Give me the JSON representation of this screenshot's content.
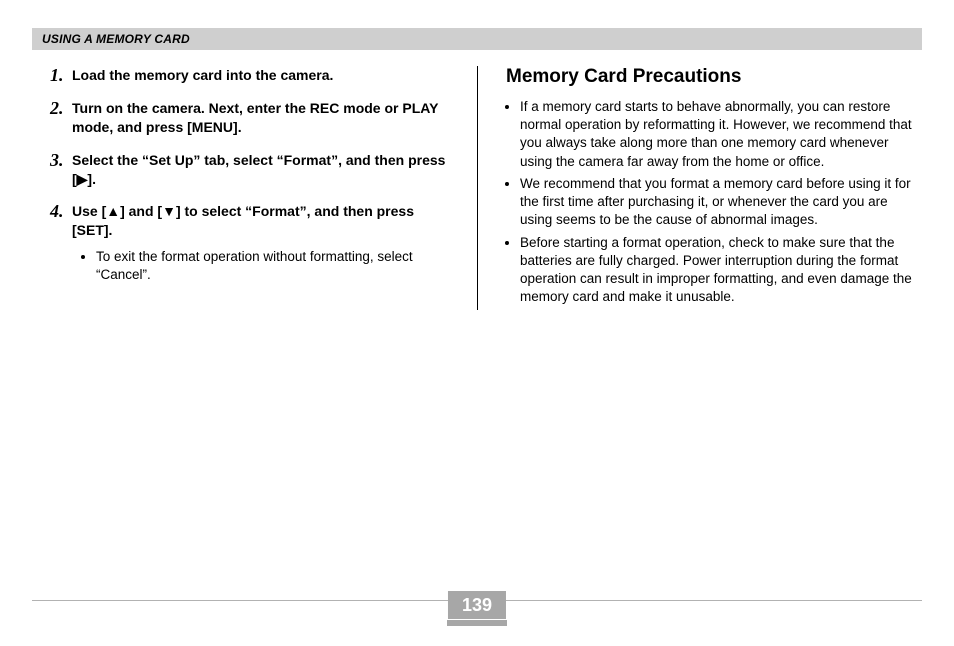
{
  "header": {
    "title": "USING A MEMORY CARD"
  },
  "left": {
    "steps": [
      {
        "num": "1.",
        "text": "Load the memory card into the camera."
      },
      {
        "num": "2.",
        "text": "Turn on the camera. Next, enter the REC mode or PLAY mode, and press [MENU]."
      },
      {
        "num": "3.",
        "text": "Select the “Set Up” tab, select “Format”, and then press [▶]."
      },
      {
        "num": "4.",
        "text": "Use [▲] and [▼] to select “Format”, and then press [SET].",
        "sub": [
          "To exit the format operation without formatting, select “Cancel”."
        ]
      }
    ]
  },
  "right": {
    "heading": "Memory Card Precautions",
    "bullets": [
      "If a memory card starts to behave abnormally, you can restore normal operation by reformatting it. However, we recommend that you always take along more than one memory card whenever using the camera far away from the home or office.",
      "We recommend that you format a memory card before using it for the first time after purchasing it, or whenever the card you are using seems to be the cause of abnormal images.",
      "Before starting a format operation, check to make sure that the batteries are fully charged. Power interruption during the format operation can result in improper formatting, and even damage the memory card and make it unusable."
    ]
  },
  "page_number": "139"
}
